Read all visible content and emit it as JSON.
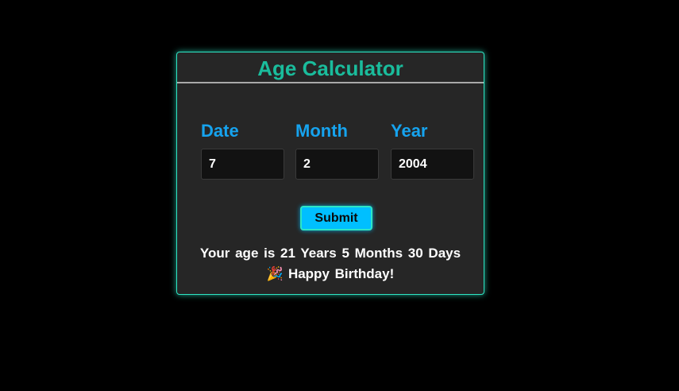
{
  "app": {
    "title": "Age Calculator"
  },
  "fields": {
    "date": {
      "label": "Date",
      "value": "7"
    },
    "month": {
      "label": "Month",
      "value": "2"
    },
    "year": {
      "label": "Year",
      "value": "2004"
    }
  },
  "submit_label": "Submit",
  "result": {
    "age_text": "Your age is 21 Years 5 Months 30 Days",
    "party_emoji": "🎉",
    "greeting": "Happy Birthday!"
  },
  "colors": {
    "background": "#000000",
    "card": "#262626",
    "accent_teal": "#1abc9c",
    "accent_blue": "#16a3ee",
    "button": "#00bfff"
  }
}
